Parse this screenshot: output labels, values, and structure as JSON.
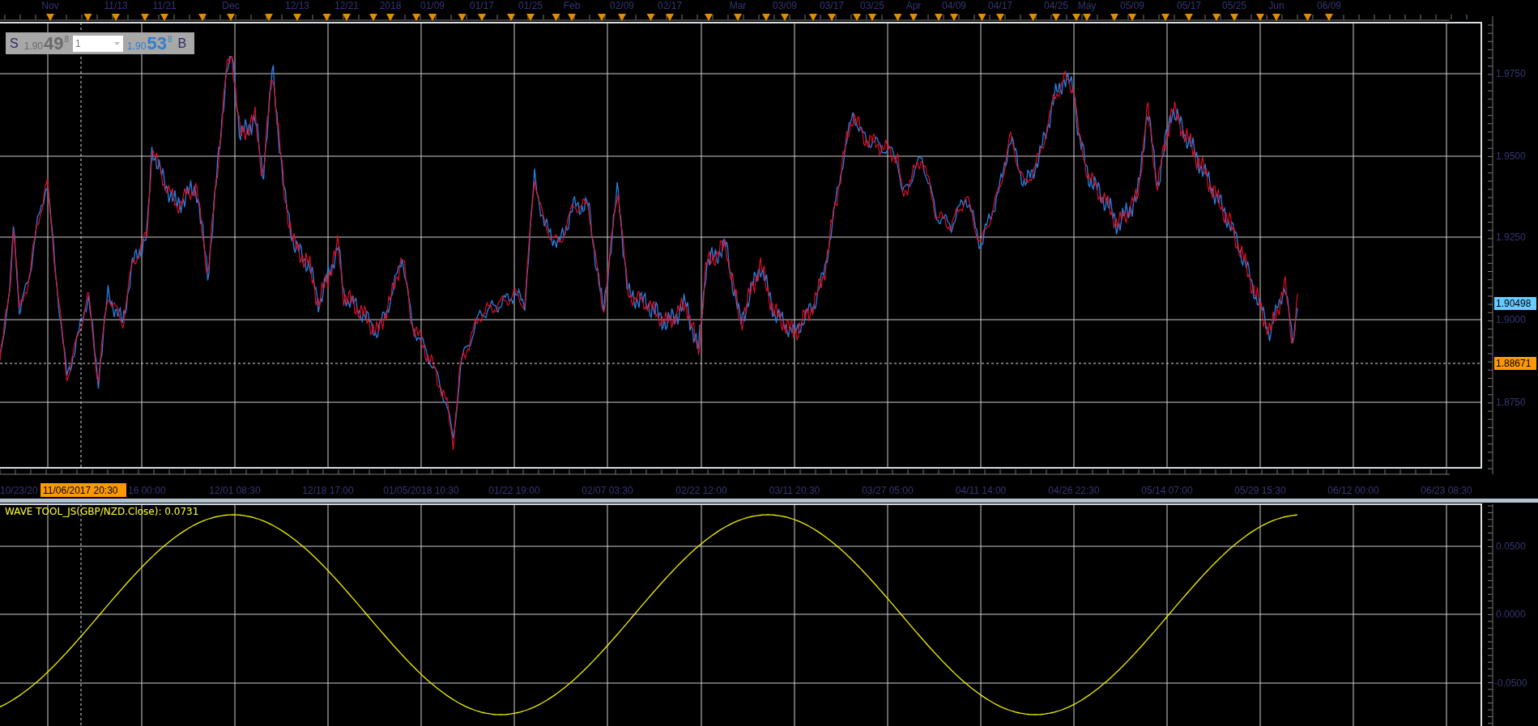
{
  "quote_panel": {
    "sell_label": "S",
    "sell_figure": "1.90",
    "sell_pips": "49",
    "sell_fraction": "8",
    "quantity": "1",
    "buy_figure": "1.90",
    "buy_pips": "53",
    "buy_fraction": "8",
    "buy_label": "B"
  },
  "top_date_axis": [
    "Nov",
    "11/13",
    "11/21",
    "Dec",
    "12/13",
    "12/21",
    "2018",
    "01/09",
    "01/17",
    "01/25",
    "Feb",
    "02/09",
    "02/17",
    "Mar",
    "03/09",
    "03/17",
    "03/25",
    "Apr",
    "04/09",
    "04/17",
    "04/25",
    "May",
    "05/09",
    "05/17",
    "05/25",
    "Jun",
    "06/09"
  ],
  "price_axis": {
    "ticks": [
      "1.9750",
      "1.9500",
      "1.9250",
      "1.9000",
      "1.8750"
    ],
    "last_price": "1.90498",
    "crosshair_price": "1.88671"
  },
  "time_axis": {
    "labels": [
      "10/23/20",
      "16 00:00",
      "12/01 08:30",
      "12/18 17:00",
      "01/05/2018 10:30",
      "01/22 19:00",
      "02/07 03:30",
      "02/22 12:00",
      "03/11 20:30",
      "03/27 05:00",
      "04/11 14:00",
      "04/26 22:30",
      "05/14 07:00",
      "05/29 15:30",
      "06/12 00:00",
      "06/23 08:30"
    ],
    "crosshair_time": "11/06/2017 20:30"
  },
  "indicator": {
    "title": "WAVE TOOL_JS(GBP/NZD.Close): 0.0731",
    "ticks": [
      "0.0500",
      "0.0000",
      "-0.0500"
    ]
  }
}
